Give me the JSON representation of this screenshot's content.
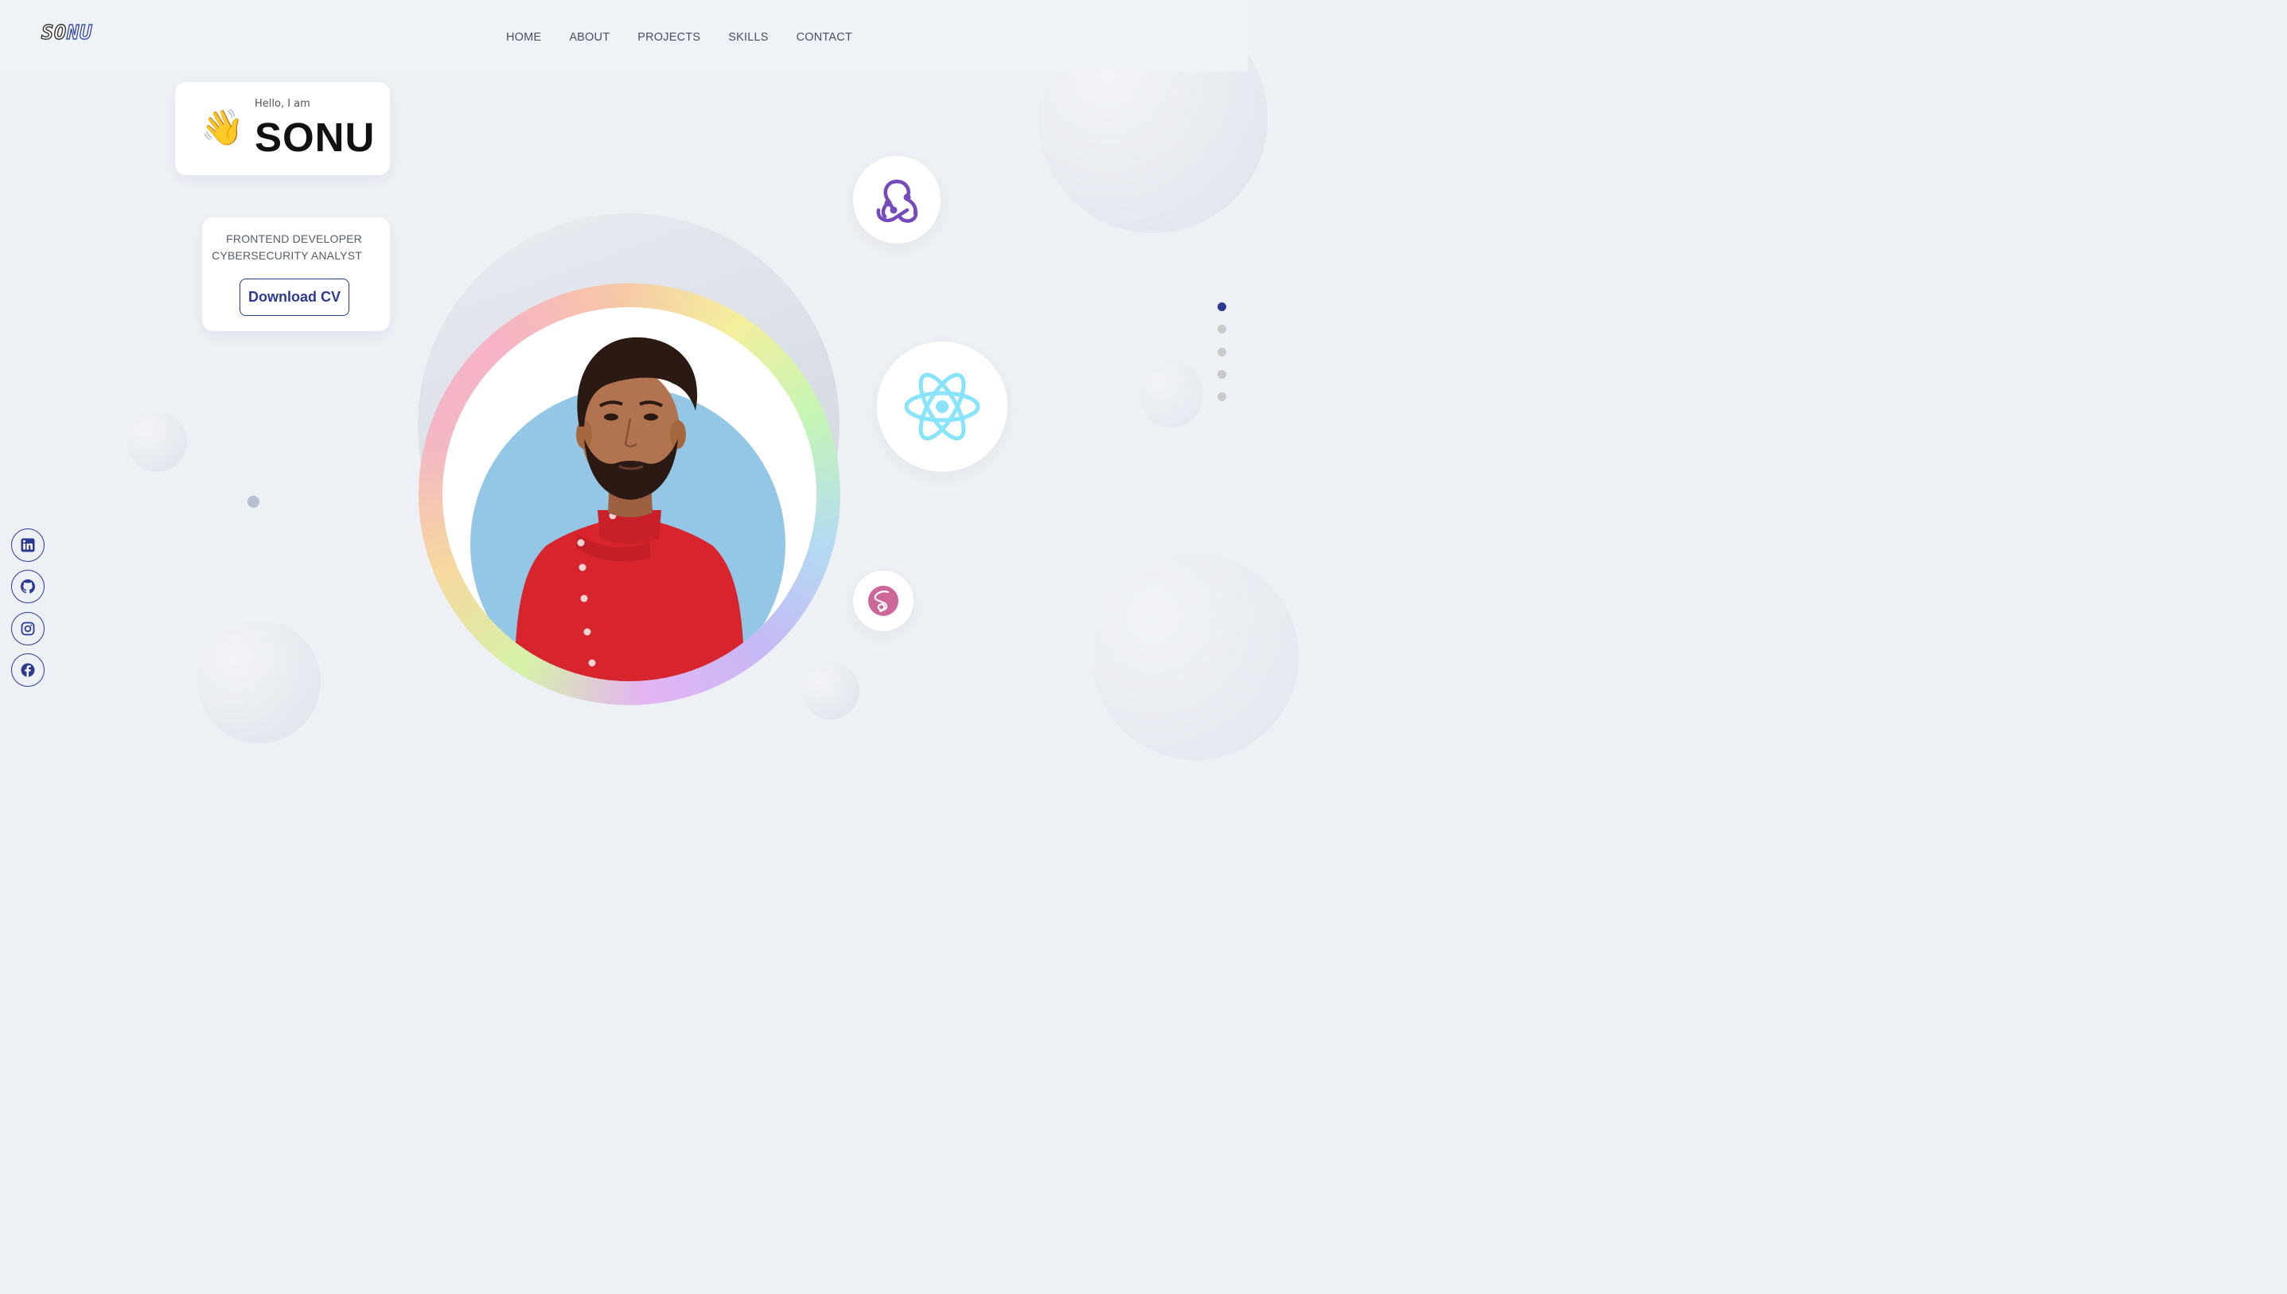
{
  "brand": {
    "logo_part1": "SO",
    "logo_part2": "NU"
  },
  "nav": {
    "items": [
      "HOME",
      "ABOUT",
      "PROJECTS",
      "SKILLS",
      "CONTACT"
    ]
  },
  "hero": {
    "greeting": "Hello, I am",
    "name": "SONU",
    "wave_emoji": "👋",
    "roles": [
      "FRONTEND DEVELOPER",
      "CYBERSECURITY ANALYST"
    ],
    "cta_label": "Download CV"
  },
  "tech_icons": [
    "redux-icon",
    "react-icon",
    "sass-icon"
  ],
  "section_dots": {
    "count": 5,
    "active_index": 0
  },
  "social": [
    "linkedin-icon",
    "github-icon",
    "instagram-icon",
    "facebook-icon"
  ],
  "colors": {
    "accent": "#2d3a92",
    "background": "#edf0f5",
    "redux": "#764abc",
    "react": "#61dafb",
    "sass": "#cd6799",
    "portrait_bg": "#94c6e6",
    "shirt": "#d8242d"
  }
}
